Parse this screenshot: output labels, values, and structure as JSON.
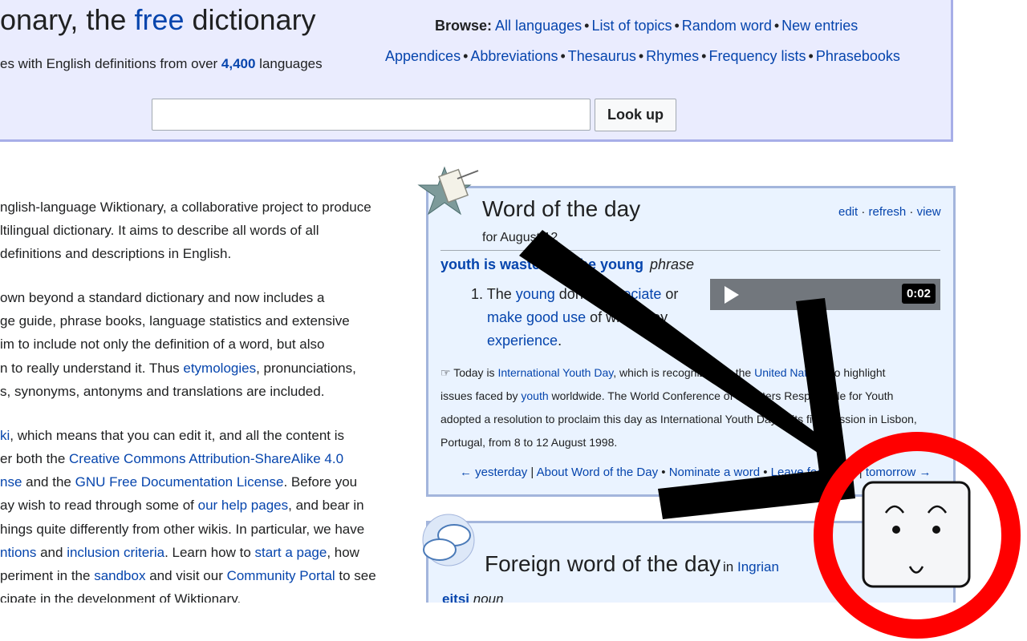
{
  "header": {
    "title_part1": "onary, the ",
    "title_free": "free",
    "title_part2": " dictionary",
    "subtitle_pre": "es with English definitions from over ",
    "subtitle_count": "4,400",
    "subtitle_post": " languages",
    "browse_label": "Browse:",
    "browse_links": [
      "All languages",
      "List of topics",
      "Random word",
      "New entries"
    ],
    "browse_links2": [
      "Appendices",
      "Abbreviations",
      "Thesaurus",
      "Rhymes",
      "Frequency lists",
      "Phrasebooks"
    ],
    "search_placeholder": "",
    "lookup_label": "Look up"
  },
  "intro": {
    "l1": "nglish-language Wiktionary, a collaborative project to produce",
    "l2": "ltilingual dictionary. It aims to describe all words of all",
    "l3": "definitions and descriptions in English.",
    "l4": "own beyond a standard dictionary and now includes a",
    "l5": "ge guide, phrase books, language statistics and extensive",
    "l6": "im to include not only the definition of a word, but also",
    "l7_pre": "n to really understand it. Thus ",
    "l7_link": "etymologies",
    "l7_post": ", pronunciations,",
    "l8": "s, synonyms, antonyms and translations are included.",
    "l9_link": "ki",
    "l9_post": ", which means that you can edit it, and all the content is",
    "l10_pre": "er both the ",
    "l10_link": "Creative Commons Attribution-ShareAlike 4.0",
    "l11_link1": "nse",
    "l11_mid": " and the ",
    "l11_link2": "GNU Free Documentation License",
    "l11_post": ". Before you",
    "l12_pre": "ay wish to read through some of ",
    "l12_link": "our help pages",
    "l12_post": ", and bear in",
    "l13": "hings quite differently from other wikis. In particular, we have",
    "l14_link1": "ntions",
    "l14_mid1": " and ",
    "l14_link2": "inclusion criteria",
    "l14_mid2": ". Learn how to ",
    "l14_link3": "start a page",
    "l14_post": ", how",
    "l15_pre": "periment in the ",
    "l15_link1": "sandbox",
    "l15_mid": " and visit our ",
    "l15_link2": "Community Portal",
    "l15_post": " to see",
    "l16": "cipate in the development of Wiktionary."
  },
  "wotd": {
    "title": "Word of the day",
    "edit": "edit",
    "refresh": "refresh",
    "view": "view",
    "date": "for August 12",
    "word": "youth is wasted on the young",
    "pos": "phrase",
    "def_num": "1.",
    "def_pre": "The ",
    "def_link1": "young",
    "def_link2": "appreciate",
    "def_or": " or",
    "def_link3": "make good use",
    "def_mid": " of what they",
    "def_link4": "experience",
    "def_end": ".",
    "audio_time": "0:02",
    "note1_pre": "Today is ",
    "note1_link1": "International Youth Day",
    "note1_mid": ", which is recognized by the ",
    "note1_link2": "United Nations",
    "note1_post": " to highlight",
    "note2_pre": "issues faced by ",
    "note2_link": "youth",
    "note2_post": " worldwide. The World Conference of Ministers Responsible for Youth",
    "note3": "adopted a resolution to proclaim this day as International Youth Day at its first session in Lisbon,",
    "note4": "Portugal, from 8 to 12 August 1998.",
    "nav_yesterday": "← yesterday",
    "nav_about": "About Word of the Day",
    "nav_nominate": "Nominate a word",
    "nav_leave": "Leave feedback",
    "nav_tomorrow": "tomorrow →"
  },
  "fwotd": {
    "title": "Foreign word of the day",
    "in": "in",
    "lang": "Ingrian",
    "word": "eitsi",
    "pos": "noun"
  },
  "overlay": {
    "arrow_color": "#000000",
    "circle_color": "#ff0000"
  }
}
